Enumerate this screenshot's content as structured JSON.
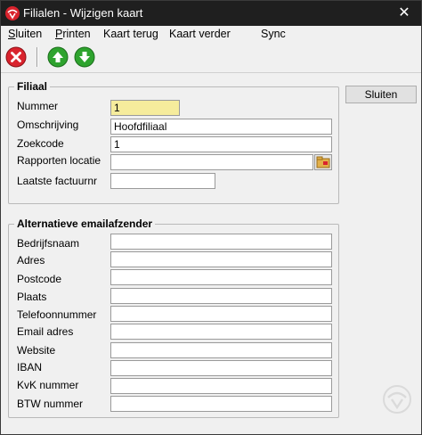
{
  "window": {
    "title": "Filialen - Wijzigen kaart",
    "close_glyph": "✕"
  },
  "menu": {
    "items": [
      {
        "u": "S",
        "rest": "luiten"
      },
      {
        "u": "P",
        "rest": "rinten"
      },
      {
        "u": "",
        "rest": "Kaart terug"
      },
      {
        "u": "",
        "rest": "Kaart verder"
      },
      {
        "u": "",
        "rest": "Sync"
      }
    ]
  },
  "toolbar": {
    "icons": [
      "close-red-icon",
      "arrow-up-green-icon",
      "arrow-down-green-icon"
    ]
  },
  "filiaal": {
    "legend": "Filiaal",
    "nummer_label": "Nummer",
    "nummer_value": "1",
    "omschrijving_label": "Omschrijving",
    "omschrijving_value": "Hoofdfiliaal",
    "zoekcode_label": "Zoekcode",
    "zoekcode_value": "1",
    "rapporten_label": "Rapporten locatie",
    "rapporten_value": "",
    "factuurnr_label": "Laatste factuurnr",
    "factuurnr_value": ""
  },
  "sluiten_button": "Sluiten",
  "email": {
    "legend": "Alternatieve emailafzender",
    "fields": [
      {
        "label": "Bedrijfsnaam",
        "value": ""
      },
      {
        "label": "Adres",
        "value": ""
      },
      {
        "label": "Postcode",
        "value": ""
      },
      {
        "label": "Plaats",
        "value": ""
      },
      {
        "label": "Telefoonnummer",
        "value": ""
      },
      {
        "label": "Email adres",
        "value": ""
      },
      {
        "label": "Website",
        "value": ""
      },
      {
        "label": "IBAN",
        "value": ""
      },
      {
        "label": "KvK nummer",
        "value": ""
      },
      {
        "label": "BTW nummer",
        "value": ""
      }
    ]
  },
  "colors": {
    "titlebar": "#1f1f1f",
    "highlight_field": "#f6ec9c",
    "accent_red": "#d9232d",
    "accent_green": "#2ea32e"
  }
}
